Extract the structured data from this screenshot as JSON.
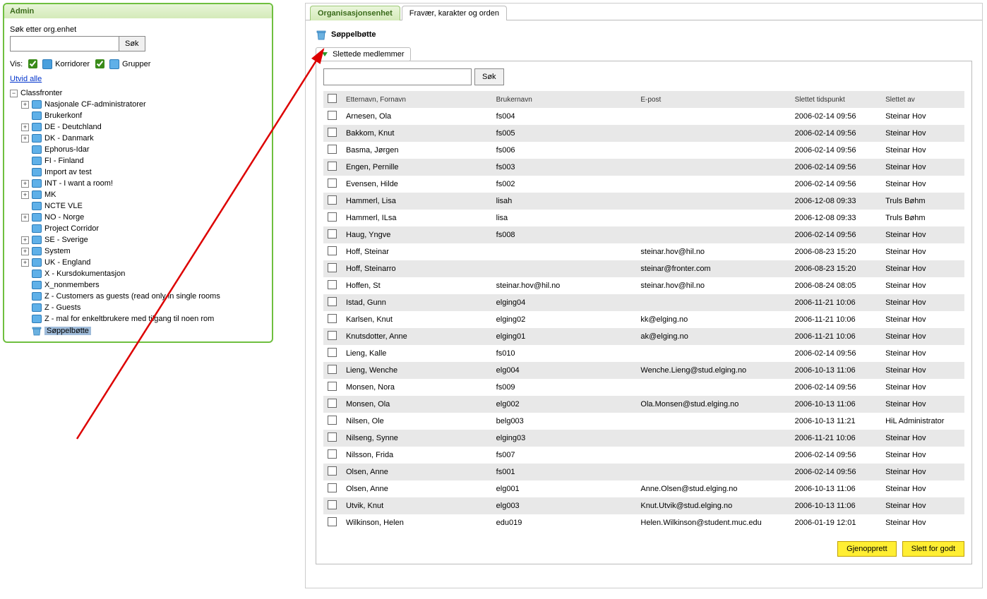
{
  "sidebar": {
    "title": "Admin",
    "search_label": "Søk etter org.enhet",
    "search_button": "Søk",
    "vis_label": "Vis:",
    "corridors_label": "Korridorer",
    "groups_label": "Grupper",
    "expand_all": "Utvid alle",
    "tree_root": "Classfronter",
    "tree_items": [
      {
        "expander": "+",
        "label": "Nasjonale CF-administratorer"
      },
      {
        "expander": "",
        "label": "Brukerkonf"
      },
      {
        "expander": "+",
        "label": "DE - Deutchland"
      },
      {
        "expander": "+",
        "label": "DK - Danmark"
      },
      {
        "expander": "",
        "label": "Ephorus-Idar"
      },
      {
        "expander": "",
        "label": "FI - Finland"
      },
      {
        "expander": "",
        "label": "Import av test"
      },
      {
        "expander": "+",
        "label": "INT - I want a room!"
      },
      {
        "expander": "+",
        "label": "MK"
      },
      {
        "expander": "",
        "label": "NCTE VLE"
      },
      {
        "expander": "+",
        "label": "NO - Norge"
      },
      {
        "expander": "",
        "label": "Project Corridor"
      },
      {
        "expander": "+",
        "label": "SE - Sverige"
      },
      {
        "expander": "+",
        "label": "System"
      },
      {
        "expander": "+",
        "label": "UK - England"
      },
      {
        "expander": "",
        "label": "X - Kursdokumentasjon"
      },
      {
        "expander": "",
        "label": "X_nonmembers"
      },
      {
        "expander": "",
        "label": "Z - Customers as guests (read only in single rooms"
      },
      {
        "expander": "",
        "label": "Z - Guests"
      },
      {
        "expander": "",
        "label": "Z - mal for enkeltbrukere med tilgang til noen rom"
      }
    ],
    "tree_selected": "Søppelbøtte"
  },
  "tabs": {
    "active": "Organisasjonsenhet",
    "inactive": "Fravær, karakter og orden"
  },
  "page": {
    "title": "Søppelbøtte",
    "subtab": "Slettede medlemmer",
    "table_search_button": "Søk"
  },
  "table": {
    "headers": {
      "name": "Etternavn, Fornavn",
      "user": "Brukernavn",
      "email": "E-post",
      "deleted_at": "Slettet tidspunkt",
      "deleted_by": "Slettet av"
    },
    "rows": [
      {
        "name": "Arnesen, Ola",
        "user": "fs004",
        "email": "",
        "time": "2006-02-14 09:56",
        "by": "Steinar Hov"
      },
      {
        "name": "Bakkom, Knut",
        "user": "fs005",
        "email": "",
        "time": "2006-02-14 09:56",
        "by": "Steinar Hov"
      },
      {
        "name": "Basma, Jørgen",
        "user": "fs006",
        "email": "",
        "time": "2006-02-14 09:56",
        "by": "Steinar Hov"
      },
      {
        "name": "Engen, Pernille",
        "user": "fs003",
        "email": "",
        "time": "2006-02-14 09:56",
        "by": "Steinar Hov"
      },
      {
        "name": "Evensen, Hilde",
        "user": "fs002",
        "email": "",
        "time": "2006-02-14 09:56",
        "by": "Steinar Hov"
      },
      {
        "name": "Hammerl, Lisa",
        "user": "lisah",
        "email": "",
        "time": "2006-12-08 09:33",
        "by": "Truls Bøhm"
      },
      {
        "name": "Hammerl, ILsa",
        "user": "lisa",
        "email": "",
        "time": "2006-12-08 09:33",
        "by": "Truls Bøhm"
      },
      {
        "name": "Haug, Yngve",
        "user": "fs008",
        "email": "",
        "time": "2006-02-14 09:56",
        "by": "Steinar Hov"
      },
      {
        "name": "Hoff, Steinar",
        "user": "",
        "email": "steinar.hov@hil.no",
        "time": "2006-08-23 15:20",
        "by": "Steinar Hov"
      },
      {
        "name": "Hoff, Steinarro",
        "user": "",
        "email": "steinar@fronter.com",
        "time": "2006-08-23 15:20",
        "by": "Steinar Hov"
      },
      {
        "name": "Hoffen, St",
        "user": "steinar.hov@hil.no",
        "email": "steinar.hov@hil.no",
        "time": "2006-08-24 08:05",
        "by": "Steinar Hov"
      },
      {
        "name": "Istad, Gunn",
        "user": "elging04",
        "email": "",
        "time": "2006-11-21 10:06",
        "by": "Steinar Hov"
      },
      {
        "name": "Karlsen, Knut",
        "user": "elging02",
        "email": "kk@elging.no",
        "time": "2006-11-21 10:06",
        "by": "Steinar Hov"
      },
      {
        "name": "Knutsdotter, Anne",
        "user": "elging01",
        "email": "ak@elging.no",
        "time": "2006-11-21 10:06",
        "by": "Steinar Hov"
      },
      {
        "name": "Lieng, Kalle",
        "user": "fs010",
        "email": "",
        "time": "2006-02-14 09:56",
        "by": "Steinar Hov"
      },
      {
        "name": "Lieng, Wenche",
        "user": "elg004",
        "email": "Wenche.Lieng@stud.elging.no",
        "time": "2006-10-13 11:06",
        "by": "Steinar Hov"
      },
      {
        "name": "Monsen, Nora",
        "user": "fs009",
        "email": "",
        "time": "2006-02-14 09:56",
        "by": "Steinar Hov"
      },
      {
        "name": "Monsen, Ola",
        "user": "elg002",
        "email": "Ola.Monsen@stud.elging.no",
        "time": "2006-10-13 11:06",
        "by": "Steinar Hov"
      },
      {
        "name": "Nilsen, Ole",
        "user": "belg003",
        "email": "",
        "time": "2006-10-13 11:21",
        "by": "HiL Administrator"
      },
      {
        "name": "Nilseng, Synne",
        "user": "elging03",
        "email": "",
        "time": "2006-11-21 10:06",
        "by": "Steinar Hov"
      },
      {
        "name": "Nilsson, Frida",
        "user": "fs007",
        "email": "",
        "time": "2006-02-14 09:56",
        "by": "Steinar Hov"
      },
      {
        "name": "Olsen, Anne",
        "user": "fs001",
        "email": "",
        "time": "2006-02-14 09:56",
        "by": "Steinar Hov"
      },
      {
        "name": "Olsen, Anne",
        "user": "elg001",
        "email": "Anne.Olsen@stud.elging.no",
        "time": "2006-10-13 11:06",
        "by": "Steinar Hov"
      },
      {
        "name": "Utvik, Knut",
        "user": "elg003",
        "email": "Knut.Utvik@stud.elging.no",
        "time": "2006-10-13 11:06",
        "by": "Steinar Hov"
      },
      {
        "name": "Wilkinson, Helen",
        "user": "edu019",
        "email": "Helen.Wilkinson@student.muc.edu",
        "time": "2006-01-19 12:01",
        "by": "Steinar Hov"
      }
    ]
  },
  "footer": {
    "restore": "Gjenopprett",
    "delete": "Slett for godt"
  }
}
